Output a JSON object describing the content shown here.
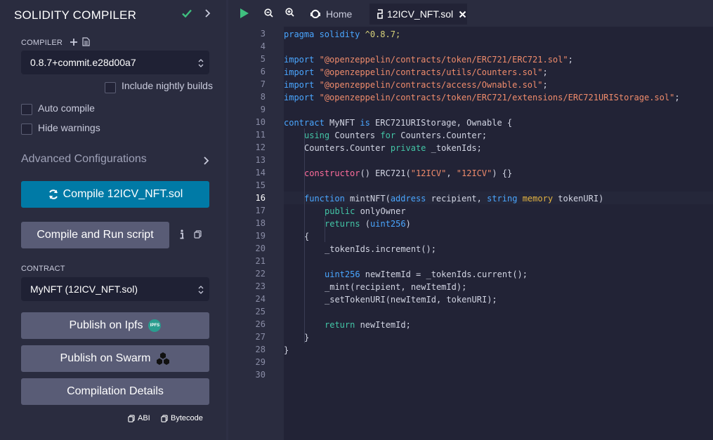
{
  "panel": {
    "title": "SOLIDITY COMPILER",
    "compiler_label": "COMPILER",
    "compiler_version": "0.8.7+commit.e28d00a7",
    "include_nightly": "Include nightly builds",
    "auto_compile": "Auto compile",
    "hide_warnings": "Hide warnings",
    "advanced": "Advanced Configurations",
    "compile_button": "Compile 12ICV_NFT.sol",
    "run_script_button": "Compile and Run script",
    "contract_label": "CONTRACT",
    "contract_value": "MyNFT (12ICV_NFT.sol)",
    "publish_ipfs": "Publish on Ipfs",
    "ipfs_badge": "IPFS",
    "publish_swarm": "Publish on Swarm",
    "compilation_details": "Compilation Details",
    "abi": "ABI",
    "bytecode": "Bytecode",
    "accent_color": "#007aa6"
  },
  "tabs": {
    "home": "Home",
    "file": "12ICV_NFT.sol"
  },
  "editor": {
    "line_numbers": [
      "3",
      "4",
      "5",
      "6",
      "7",
      "8",
      "9",
      "10",
      "11",
      "12",
      "13",
      "14",
      "15",
      "16",
      "17",
      "18",
      "19",
      "20",
      "21",
      "22",
      "23",
      "24",
      "25",
      "26",
      "27",
      "28",
      "29",
      "30"
    ],
    "current_line": "16",
    "code": {
      "pragma_kw": "pragma solidity",
      "pragma_ver": " ^0.8.7;",
      "import_kw": "import",
      "imp1": "\"@openzeppelin/contracts/token/ERC721/ERC721.sol\"",
      "imp2": "\"@openzeppelin/contracts/utils/Counters.sol\"",
      "imp3": "\"@openzeppelin/contracts/access/Ownable.sol\"",
      "imp4": "\"@openzeppelin/contracts/token/ERC721/extensions/ERC721URIStorage.sol\"",
      "semi": ";",
      "contract_kw": "contract",
      "contract_name": " MyNFT ",
      "is_kw": "is",
      "contract_rest": " ERC721URIStorage, Ownable {",
      "using_kw": "using",
      "counters": " Counters ",
      "for_kw": "for",
      "counter_rest": " Counters.Counter;",
      "counter_var": "Counters.Counter ",
      "private_kw": "private",
      "tokenids_rest": " _tokenIds;",
      "constructor_kw": "constructor",
      "ctor_a": "() ERC721(",
      "ctor_s1": "\"12ICV\"",
      "ctor_comma": ", ",
      "ctor_s2": "\"12ICV\"",
      "ctor_end": ") {}",
      "function_kw": "function",
      "fn_name": " mintNFT(",
      "address_kw": "address",
      "fn_p1": " recipient, ",
      "string_kw": "string",
      "space": " ",
      "memory_kw": "memory",
      "fn_p2": " tokenURI)",
      "public_kw": "public",
      "only_owner": " onlyOwner",
      "returns_kw": "returns",
      "ret_open": " (",
      "uint_kw": "uint256",
      "ret_close": ")",
      "brace_open": "{",
      "increment": "_tokenIds.increment();",
      "newitem_rest": " newItemId = _tokenIds.current();",
      "mint": "_mint(recipient, newItemId);",
      "settoken": "_setTokenURI(newItemId, tokenURI);",
      "return_kw": "return",
      "return_rest": " newItemId;",
      "brace_close": "}"
    }
  }
}
